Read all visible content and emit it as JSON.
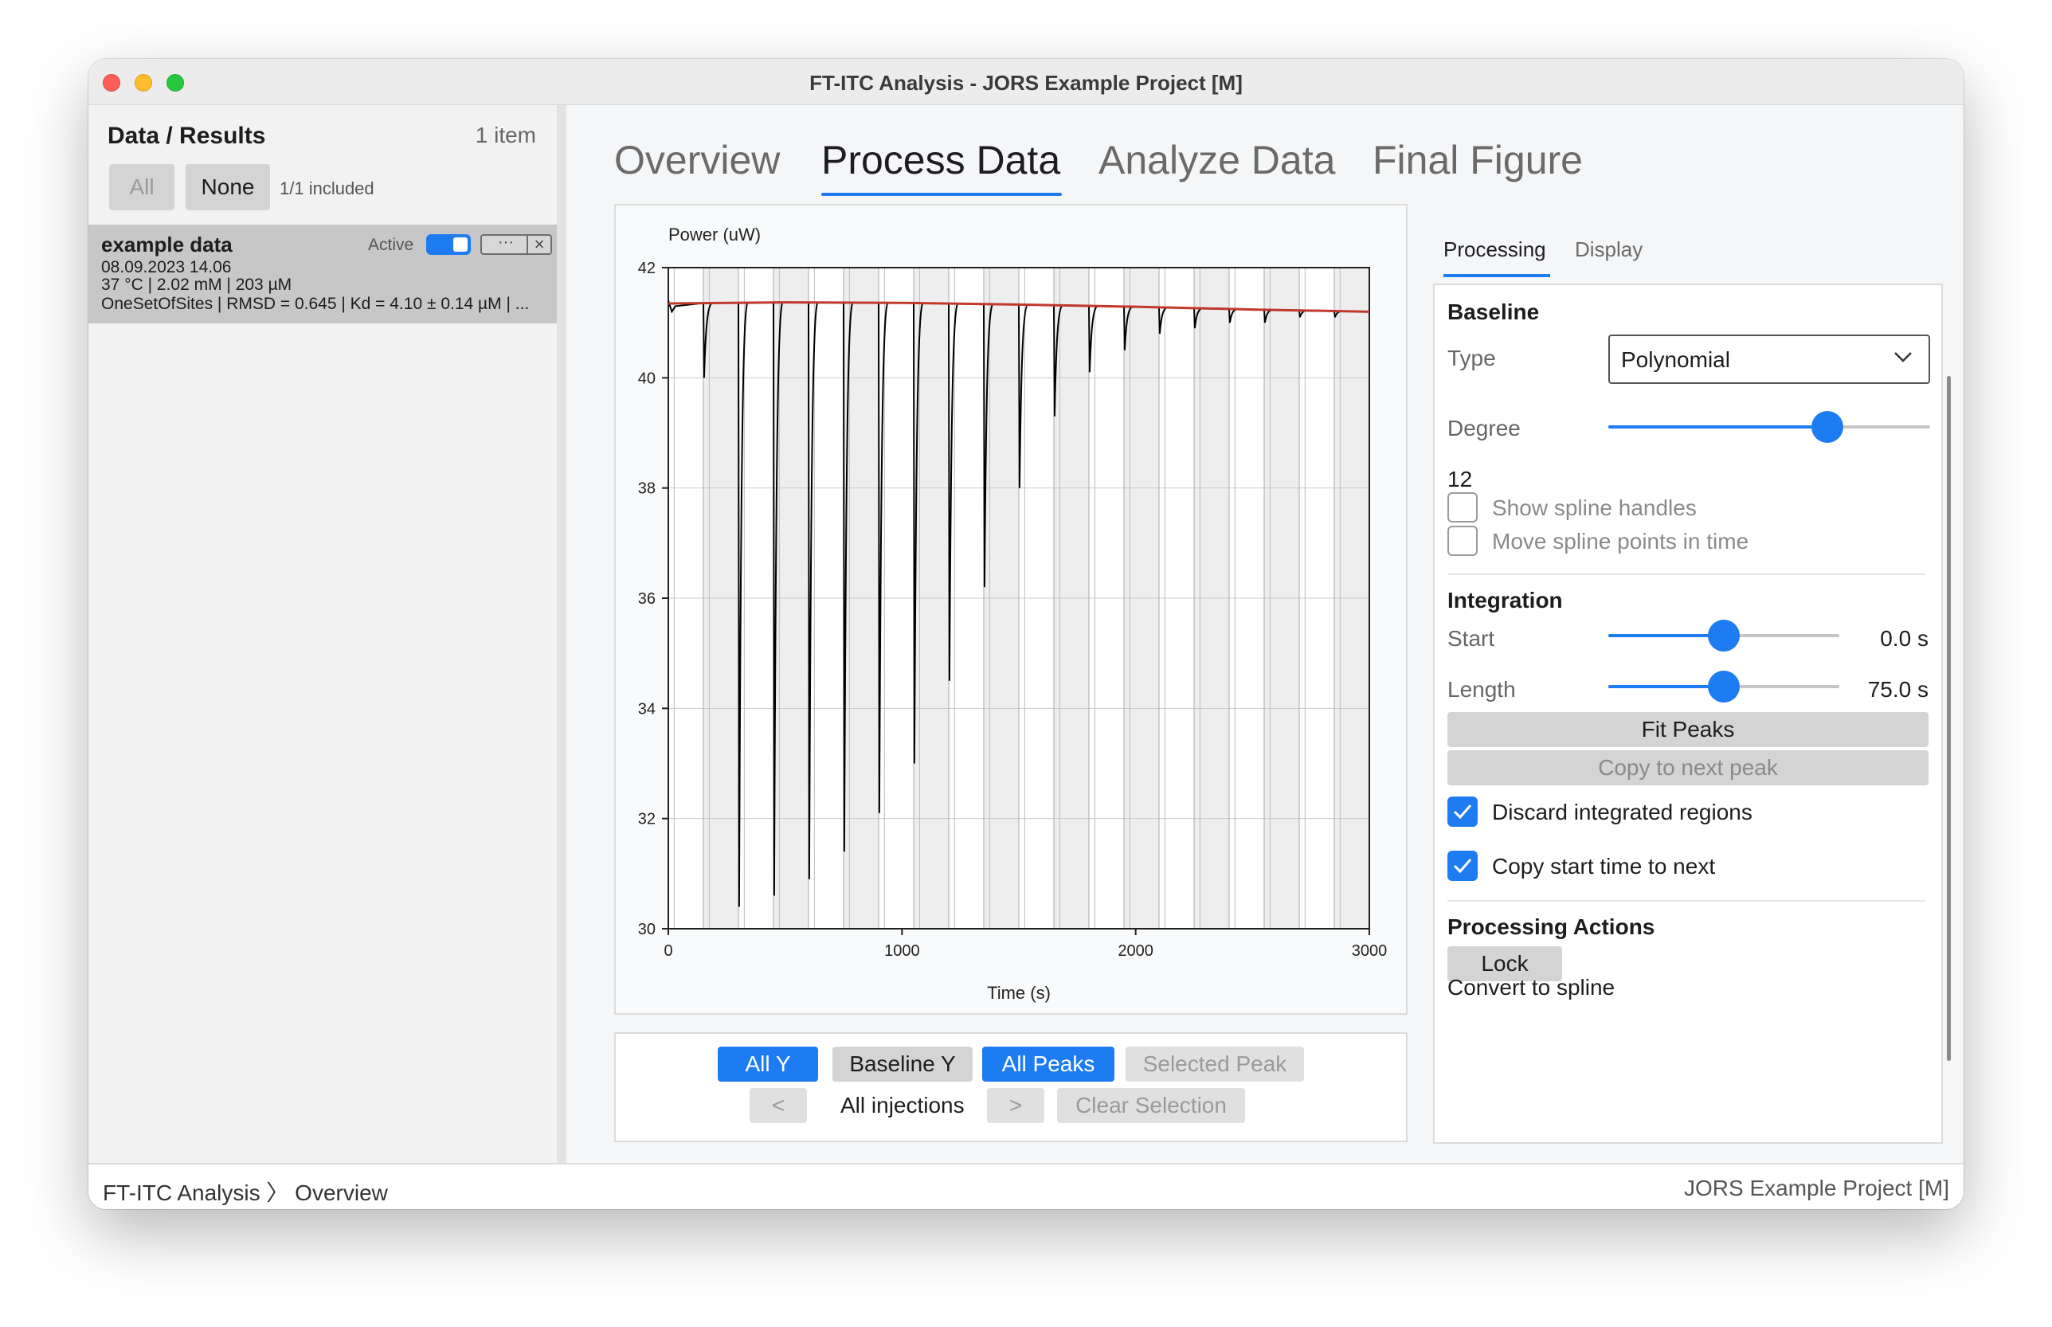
{
  "window": {
    "title": "FT-ITC Analysis - JORS Example Project [M]"
  },
  "sidebar": {
    "title": "Data / Results",
    "count": "1 item",
    "all_label": "All",
    "none_label": "None",
    "included": "1/1 included",
    "item": {
      "name": "example data",
      "active_label": "Active",
      "active": true,
      "more_label": "···",
      "close_label": "×",
      "date": "08.09.2023 14.06",
      "conditions": "37 °C | 2.02 mM | 203 µM",
      "fit": "OneSetOfSites | RMSD = 0.645 | Kd = 4.10 ± 0.14 µM | ..."
    }
  },
  "tabs": [
    {
      "label": "Overview"
    },
    {
      "label": "Process Data",
      "active": true
    },
    {
      "label": "Analyze Data"
    },
    {
      "label": "Final Figure"
    }
  ],
  "chart_data": {
    "type": "line",
    "ylabel": "Power (uW)",
    "xlabel": "Time (s)",
    "xlim": [
      0,
      3000
    ],
    "ylim": [
      30,
      42
    ],
    "xticks": [
      0,
      1000,
      2000,
      3000
    ],
    "yticks": [
      30,
      32,
      34,
      36,
      38,
      40,
      42
    ],
    "grid": true,
    "injection_times": [
      0,
      150,
      300,
      450,
      600,
      750,
      900,
      1050,
      1200,
      1350,
      1500,
      1650,
      1800,
      1950,
      2100,
      2250,
      2400,
      2550,
      2700,
      2850,
      3000
    ],
    "series": [
      {
        "color": "#000000",
        "start": [
          0,
          41.4
        ],
        "end": [
          3000,
          41.2
        ],
        "peaks": [
          {
            "x": 150,
            "min": 40.0
          },
          {
            "x": 300,
            "min": 30.4
          },
          {
            "x": 450,
            "min": 30.6
          },
          {
            "x": 600,
            "min": 30.9
          },
          {
            "x": 750,
            "min": 31.4
          },
          {
            "x": 900,
            "min": 32.1
          },
          {
            "x": 1050,
            "min": 33.0
          },
          {
            "x": 1200,
            "min": 34.5
          },
          {
            "x": 1350,
            "min": 36.2
          },
          {
            "x": 1500,
            "min": 38.0
          },
          {
            "x": 1650,
            "min": 39.3
          },
          {
            "x": 1800,
            "min": 40.1
          },
          {
            "x": 1950,
            "min": 40.5
          },
          {
            "x": 2100,
            "min": 40.8
          },
          {
            "x": 2250,
            "min": 40.9
          },
          {
            "x": 2400,
            "min": 41.0
          },
          {
            "x": 2550,
            "min": 41.0
          },
          {
            "x": 2700,
            "min": 41.1
          },
          {
            "x": 2850,
            "min": 41.1
          }
        ]
      },
      {
        "color": "#c0392b",
        "x": [
          0,
          500,
          1000,
          1500,
          2000,
          2500,
          3000
        ],
        "values": [
          41.35,
          41.37,
          41.36,
          41.33,
          41.29,
          41.24,
          41.2
        ]
      }
    ]
  },
  "controls": {
    "all_y": "All Y",
    "baseline_y": "Baseline Y",
    "all_peaks": "All Peaks",
    "selected_peak": "Selected Peak",
    "prev": "<",
    "injections": "All injections",
    "next": ">",
    "clear_selection": "Clear Selection"
  },
  "right_tabs": {
    "processing": "Processing",
    "display": "Display"
  },
  "processing": {
    "baseline_heading": "Baseline",
    "type_label": "Type",
    "type_value": "Polynomial",
    "degree_label": "Degree",
    "degree_value": "12",
    "degree_fraction": 0.68,
    "show_spline_handles": "Show spline handles",
    "move_spline_points": "Move spline points in time",
    "integration_heading": "Integration",
    "start_label": "Start",
    "start_value": "0.0 s",
    "start_fraction": 0.5,
    "length_label": "Length",
    "length_value": "75.0 s",
    "length_fraction": 0.5,
    "fit_peaks": "Fit Peaks",
    "copy_next_peak": "Copy to next peak",
    "discard_regions": "Discard integrated regions",
    "discard_checked": true,
    "copy_start_time": "Copy start time to next",
    "copy_start_checked": true,
    "actions_heading": "Processing Actions",
    "lock": "Lock",
    "convert_spline": "Convert to spline"
  },
  "status": {
    "app": "FT-ITC Analysis",
    "separator": "〉",
    "page": "Overview",
    "project": "JORS Example Project [M]"
  },
  "colors": {
    "accent": "#1e7cf2",
    "baseline": "#c0392b",
    "signal": "#000000"
  }
}
